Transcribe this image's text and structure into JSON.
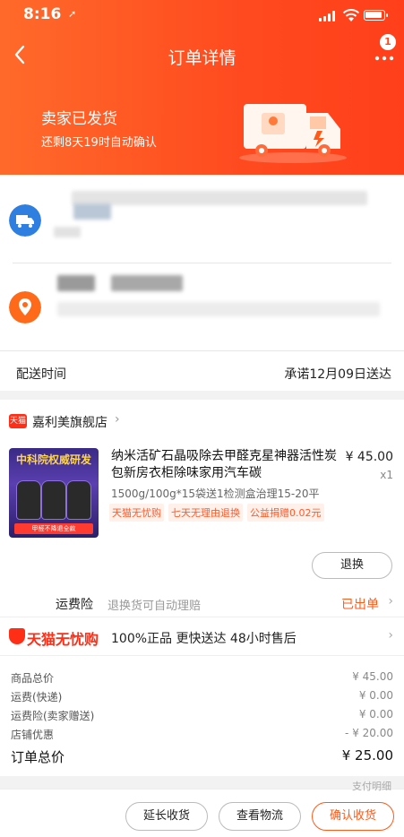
{
  "status_bar": {
    "time": "8:16",
    "location_glyph": "➚"
  },
  "header": {
    "title": "订单详情",
    "badge_count": "1"
  },
  "banner": {
    "heading": "卖家已发货",
    "subtext": "还剩8天19时自动确认"
  },
  "delivery": {
    "label": "配送时间",
    "value": "承诺12月09日送达"
  },
  "shop": {
    "tag": "天猫",
    "name": "嘉利美旗舰店",
    "product": {
      "thumb_title": "中科院权威研发",
      "thumb_banner": "甲醛不降退全款",
      "name": "纳米活矿石晶吸除去甲醛克星神器活性炭包新房衣柜除味家用汽车碳",
      "price": "¥ 45.00",
      "qty": "x1",
      "spec": "1500g/100g*15袋送1检测盒治理15-20平",
      "tags": [
        "天猫无忧购",
        "七天无理由退换",
        "公益捐赠0.02元"
      ]
    },
    "return_button": "退换",
    "insurance": {
      "label": "运费险",
      "desc": "退换货可自动理赔",
      "status": "已出单"
    },
    "worry_free": {
      "brand": "天猫无忧购",
      "slogan": "100%正品  更快送达  48小时售后"
    },
    "fees": [
      {
        "label": "商品总价",
        "value": "¥ 45.00"
      },
      {
        "label": "运费(快递)",
        "value": "¥ 0.00"
      },
      {
        "label": "运费险(卖家赠送)",
        "value": "¥ 0.00"
      },
      {
        "label": "店铺优惠",
        "value": "- ¥ 20.00"
      }
    ],
    "total": {
      "label": "订单总价",
      "value": "¥ 25.00"
    }
  },
  "bottom": {
    "paid_hint": "支付明细",
    "extend_button": "延长收货",
    "logistics_button": "查看物流",
    "confirm_button": "确认收货"
  },
  "colors": {
    "accent": "#ff4a1f",
    "tmall_red": "#ff2e17",
    "truck_icon": "#2f7fe0",
    "pin_icon": "#ff6a1a"
  }
}
